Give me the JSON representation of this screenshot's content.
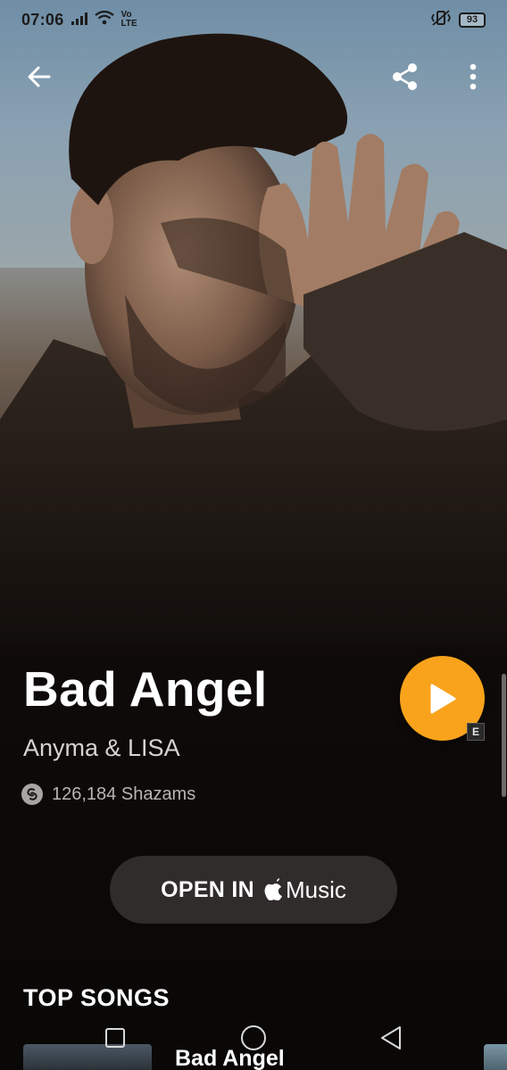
{
  "status_bar": {
    "time": "07:06",
    "network_label": "Vo LTE",
    "battery": "93"
  },
  "top_bar": {
    "back_icon": "arrow-left-icon",
    "share_icon": "share-icon",
    "more_icon": "more-vertical-icon"
  },
  "track": {
    "title": "Bad Angel",
    "artist": "Anyma & LISA",
    "shazam_count": "126,184 Shazams",
    "explicit_badge": "E"
  },
  "actions": {
    "open_in_label": "OPEN IN",
    "music_brand": "Music"
  },
  "top_songs": {
    "section_title": "TOP SONGS",
    "items": [
      {
        "title": "Bad Angel"
      }
    ]
  },
  "colors": {
    "accent": "#f8a31b",
    "background": "#0c0908",
    "button_bg": "#2f2c2b"
  }
}
